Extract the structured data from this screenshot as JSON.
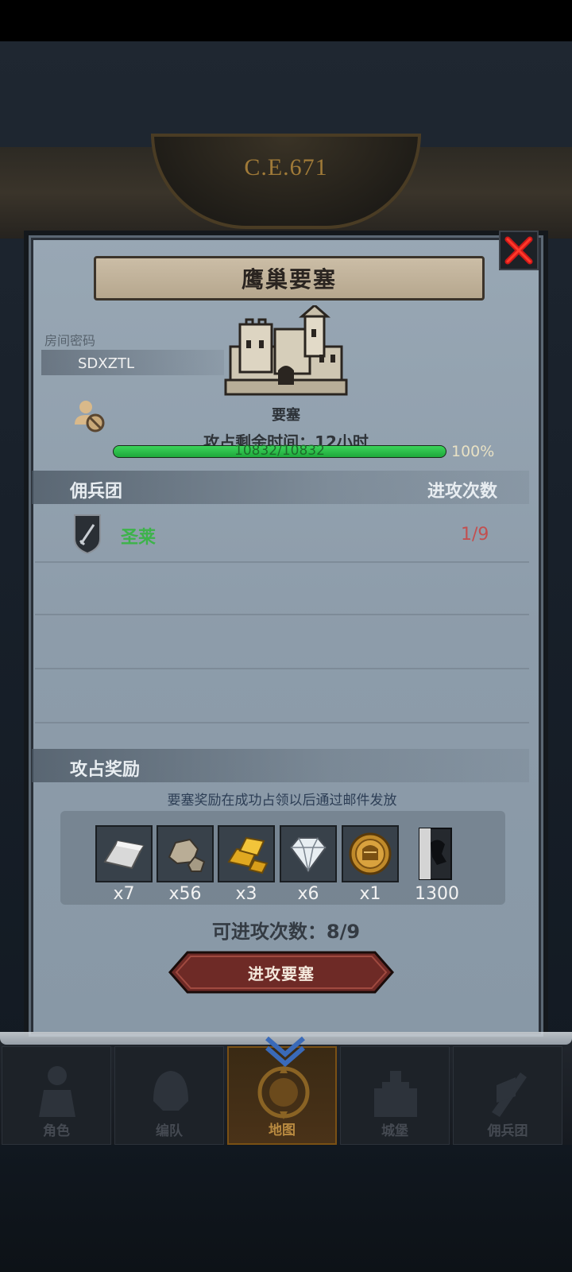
{
  "header": {
    "era": "C.E.671"
  },
  "dialog": {
    "title": "鹰巢要塞",
    "room_label": "房间密码",
    "room_code": "SDXZTL",
    "building_type": "要塞",
    "time_label": "攻占剩余时间：",
    "time_value": "12小时",
    "hp_text": "10832/10832",
    "hp_percent": "100%",
    "hp_fraction": 1.0
  },
  "mercenary": {
    "section_title": "佣兵团",
    "section_right": "进攻次数",
    "rows": [
      {
        "name": "圣莱",
        "count": "1/9",
        "icon": "sword-shield-icon"
      }
    ]
  },
  "rewards": {
    "section_title": "攻占奖励",
    "note": "要塞奖励在成功占领以后通过邮件发放",
    "items": [
      {
        "icon": "silver-ingot-icon",
        "qty": "x7"
      },
      {
        "icon": "stone-ore-icon",
        "qty": "x56"
      },
      {
        "icon": "gold-bars-icon",
        "qty": "x3"
      },
      {
        "icon": "diamond-icon",
        "qty": "x6"
      },
      {
        "icon": "knight-medal-icon",
        "qty": "x1"
      }
    ],
    "reputation": {
      "icon": "reputation-icon",
      "qty": "1300"
    }
  },
  "attacks": {
    "label": "可进攻次数：",
    "value": "8/9"
  },
  "attack_button": {
    "label": "进攻要塞"
  },
  "nav": {
    "tabs": [
      {
        "label": "角色"
      },
      {
        "label": "编队"
      },
      {
        "label": "地图"
      },
      {
        "label": "城堡"
      },
      {
        "label": "佣兵团"
      }
    ],
    "active_index": 2
  }
}
